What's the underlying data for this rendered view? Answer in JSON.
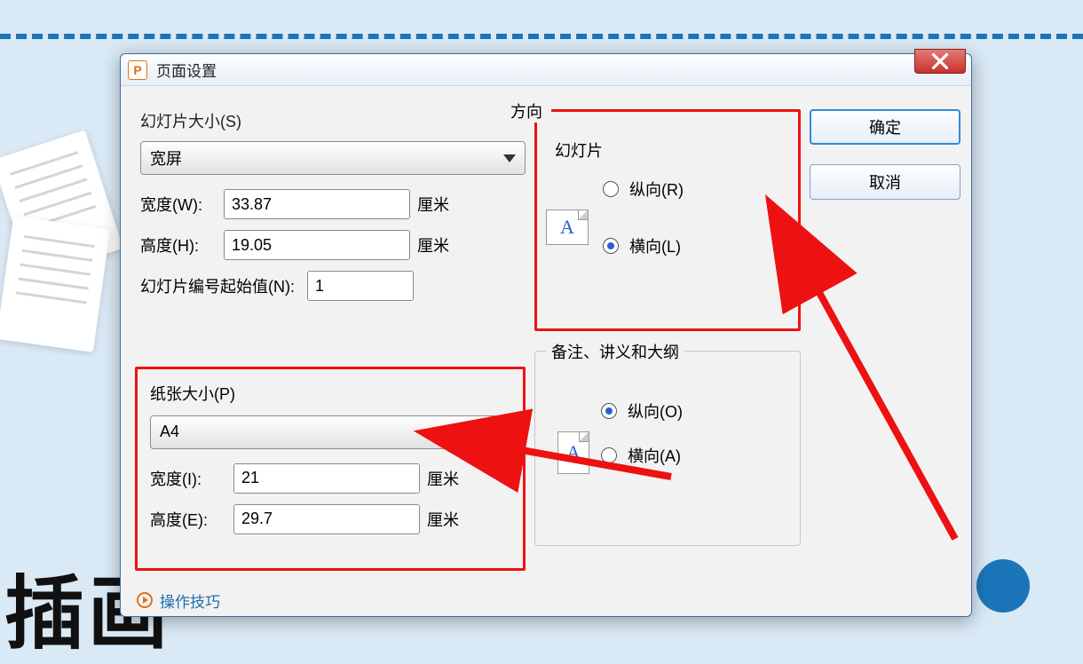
{
  "dialog": {
    "title": "页面设置",
    "ok": "确定",
    "cancel": "取消",
    "tips": "操作技巧"
  },
  "slideSize": {
    "legend": "幻灯片大小(S)",
    "preset": "宽屏",
    "widthLabel": "宽度(W):",
    "widthValue": "33.87",
    "heightLabel": "高度(H):",
    "heightValue": "19.05",
    "numberLabel": "幻灯片编号起始值(N):",
    "numberValue": "1",
    "unit": "厘米"
  },
  "paperSize": {
    "legend": "纸张大小(P)",
    "preset": "A4",
    "widthLabel": "宽度(I):",
    "widthValue": "21",
    "heightLabel": "高度(E):",
    "heightValue": "29.7",
    "unit": "厘米"
  },
  "orientation": {
    "groupLegend": "方向",
    "slides": {
      "title": "幻灯片",
      "portrait": "纵向(R)",
      "landscape": "横向(L)",
      "selected": "landscape"
    },
    "notes": {
      "title": "备注、讲义和大纲",
      "portrait": "纵向(O)",
      "landscape": "横向(A)",
      "selected": "portrait"
    }
  },
  "bgText": "插画"
}
